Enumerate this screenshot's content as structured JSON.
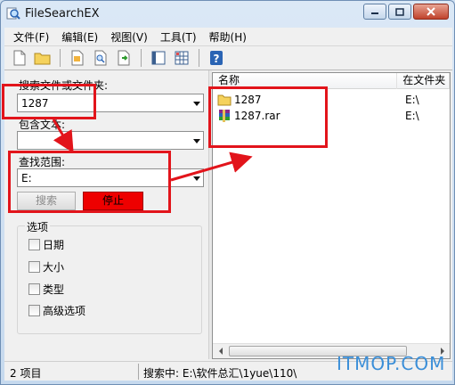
{
  "window": {
    "title": "FileSearchEX"
  },
  "menu": {
    "items": [
      "文件(F)",
      "编辑(E)",
      "视图(V)",
      "工具(T)",
      "帮助(H)"
    ]
  },
  "toolbar": {
    "icons": [
      "new-file-icon",
      "open-folder-icon",
      "copy-document-icon",
      "find-document-icon",
      "export-icon",
      "panel-icon",
      "grid-icon",
      "help-icon"
    ]
  },
  "search_panel": {
    "name_label": "搜索文件或文件夹:",
    "name_value": "1287",
    "content_label": "包含文本:",
    "content_value": "",
    "scope_label": "查找范围:",
    "scope_value": "E:",
    "search_button": "搜索",
    "stop_button": "停止",
    "options_title": "选项",
    "options": [
      {
        "label": "日期",
        "checked": false
      },
      {
        "label": "大小",
        "checked": false
      },
      {
        "label": "类型",
        "checked": false
      },
      {
        "label": "高级选项",
        "checked": false
      }
    ]
  },
  "results": {
    "columns": [
      "名称",
      "在文件夹"
    ],
    "rows": [
      {
        "name": "1287",
        "location": "E:\\",
        "icon": "folder-icon"
      },
      {
        "name": "1287.rar",
        "location": "E:\\",
        "icon": "rar-archive-icon"
      }
    ]
  },
  "status": {
    "count": "2 项目",
    "path": "搜索中: E:\\软件总汇\\1yue\\110\\"
  },
  "watermark": "ITMOP.COM",
  "colors": {
    "annotation": "#e2141b",
    "stop_button": "#ee0000",
    "watermark": "#3a8ed8"
  }
}
